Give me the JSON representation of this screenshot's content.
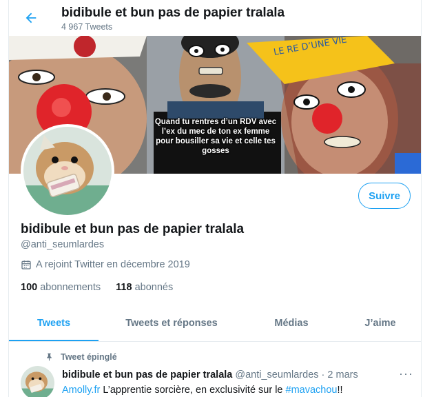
{
  "header": {
    "title": "bidibule et bun pas de papier tralala",
    "tweet_count": "4 967 Tweets"
  },
  "banner": {
    "caption": "Quand tu rentres d’un RDV avec l’ex du mec de ton ex femme pour bousiller sa vie et celle tes gosses",
    "hat_text": "LE RE D’UNE VIE"
  },
  "profile": {
    "follow_label": "Suivre",
    "name": "bidibule et bun pas de papier tralala",
    "handle": "@anti_seumlardes",
    "joined": "A rejoint Twitter en décembre 2019",
    "following_count": "100",
    "following_label": "abonnements",
    "followers_count": "118",
    "followers_label": "abonnés"
  },
  "tabs": [
    "Tweets",
    "Tweets et réponses",
    "Médias",
    "J’aime"
  ],
  "tweet": {
    "pinned_label": "Tweet épinglé",
    "author_name": "bidibule et bun pas de papier tralala",
    "author_handle": "@anti_seumlardes",
    "separator": " · ",
    "date": "2 mars",
    "more": "···",
    "link": "Amolly.fr",
    "text": " L’apprentie sorcière, en exclusivité sur le ",
    "hashtag": "#mavachou",
    "suffix": "!!"
  },
  "colors": {
    "accent": "#1da1f2",
    "secondary_text": "#657786",
    "divider": "#e6ecf0"
  },
  "icons": {
    "back": "arrow-left-icon",
    "calendar": "calendar-icon",
    "pin": "pin-icon",
    "more": "more-icon"
  }
}
